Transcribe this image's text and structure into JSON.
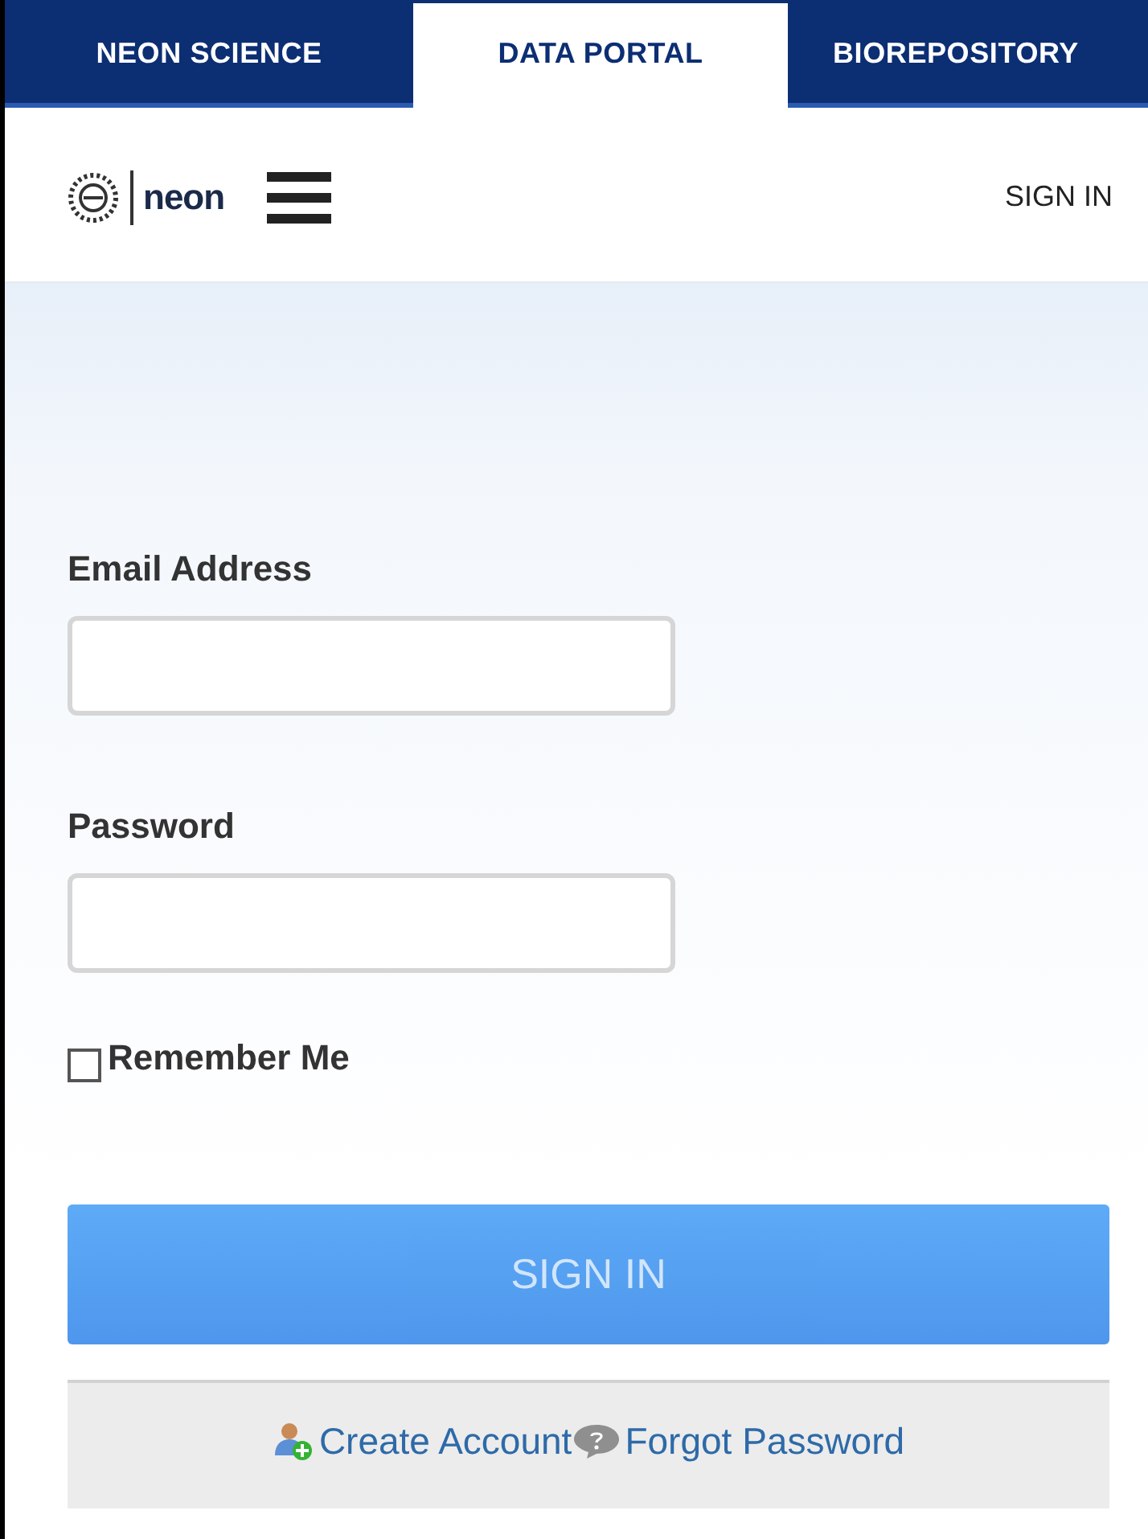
{
  "tabs": [
    {
      "label": "NEON SCIENCE",
      "selected": false
    },
    {
      "label": "DATA PORTAL",
      "selected": true
    },
    {
      "label": "BIOREPOSITORY",
      "selected": false
    }
  ],
  "header": {
    "logo_text": "neon",
    "sign_in_link": "SIGN IN"
  },
  "form": {
    "fields": [
      {
        "label": "Email Address"
      },
      {
        "label": "Password"
      }
    ],
    "remember": {
      "label": "Remember Me",
      "checked": false
    },
    "submit": {
      "label": "SIGN IN",
      "disabled": true
    }
  },
  "footer": {
    "links": [
      {
        "kind": "create",
        "label": "Create Account"
      },
      {
        "kind": "help",
        "label": "Forgot Password"
      }
    ]
  }
}
